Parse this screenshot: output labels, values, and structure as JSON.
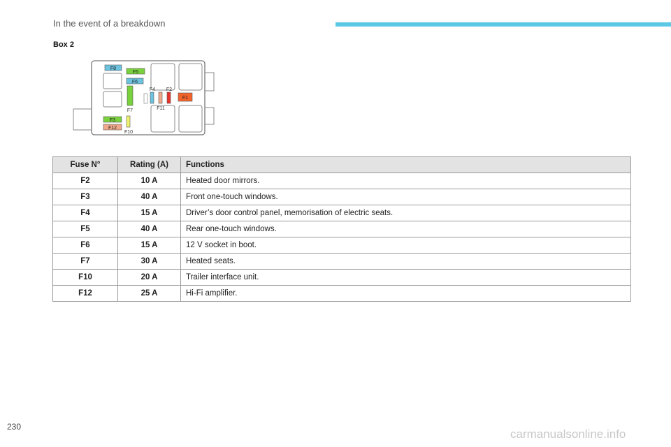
{
  "header": {
    "title": "In the event of a breakdown",
    "accent_color": "#5bc8e6"
  },
  "box_label": "Box 2",
  "diagram": {
    "labels": {
      "f8": "F8",
      "f5": "F5",
      "f6": "F6",
      "f4": "F4",
      "f2": "F2",
      "f1": "F1",
      "f11": "F11",
      "f7": "F7",
      "f3": "F3",
      "f12": "F12",
      "f10": "F10"
    },
    "colors": {
      "blue": "#6cc3e0",
      "green": "#7ad13e",
      "red": "#e8332b",
      "orange": "#f2642b",
      "salmon": "#f0a98a",
      "yellow": "#eef26a"
    }
  },
  "table": {
    "headers": {
      "fuse": "Fuse N°",
      "rating": "Rating (A)",
      "functions": "Functions"
    },
    "rows": [
      {
        "fuse": "F2",
        "rating": "10 A",
        "function": "Heated door mirrors."
      },
      {
        "fuse": "F3",
        "rating": "40 A",
        "function": "Front one-touch windows."
      },
      {
        "fuse": "F4",
        "rating": "15 A",
        "function": "Driver’s door control panel, memorisation of electric seats."
      },
      {
        "fuse": "F5",
        "rating": "40 A",
        "function": "Rear one-touch windows."
      },
      {
        "fuse": "F6",
        "rating": "15 A",
        "function": "12 V socket in boot."
      },
      {
        "fuse": "F7",
        "rating": "30 A",
        "function": "Heated seats."
      },
      {
        "fuse": "F10",
        "rating": "20 A",
        "function": "Trailer interface unit."
      },
      {
        "fuse": "F12",
        "rating": "25 A",
        "function": "Hi-Fi amplifier."
      }
    ]
  },
  "footer": {
    "page_number": "230",
    "watermark": "carmanualsonline.info"
  }
}
